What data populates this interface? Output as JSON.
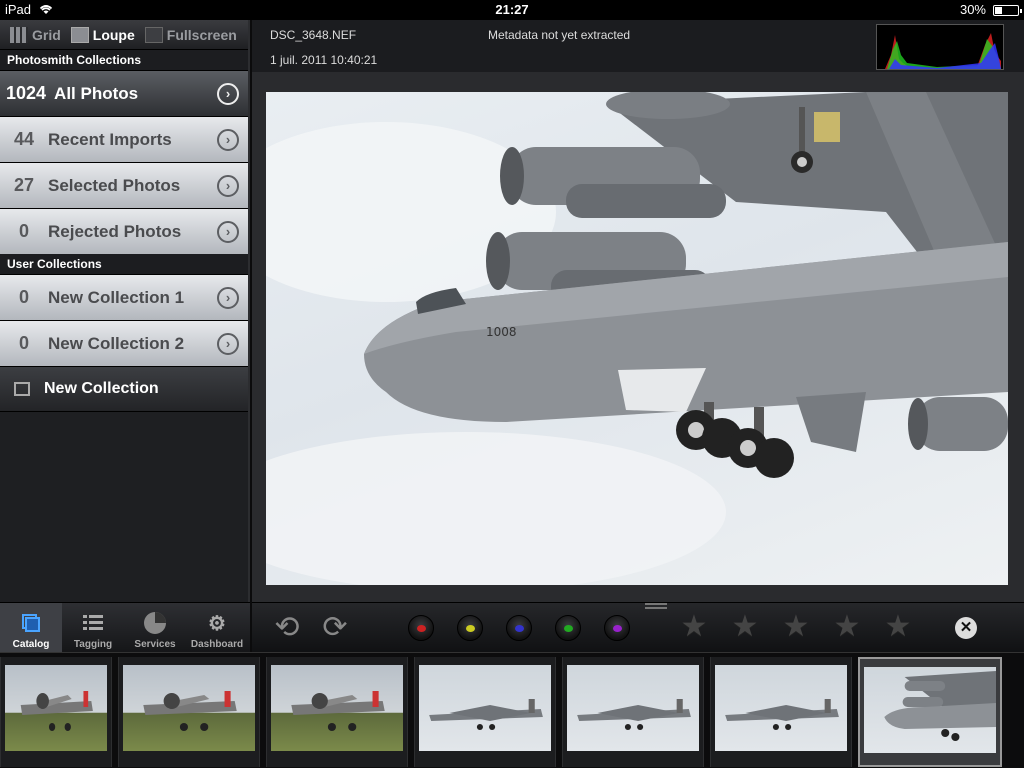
{
  "status": {
    "device": "iPad",
    "time": "21:27",
    "battery": "30%",
    "battery_level": 0.3
  },
  "viewmodes": [
    {
      "label": "Grid",
      "active": false
    },
    {
      "label": "Loupe",
      "active": true
    },
    {
      "label": "Fullscreen",
      "active": false
    }
  ],
  "sections": {
    "photosmith": "Photosmith Collections",
    "user": "User Collections"
  },
  "collections": [
    {
      "count": "1024",
      "label": "All Photos",
      "selected": true
    },
    {
      "count": "44",
      "label": "Recent Imports"
    },
    {
      "count": "27",
      "label": "Selected Photos"
    },
    {
      "count": "0",
      "label": "Rejected Photos"
    }
  ],
  "user_collections": [
    {
      "count": "0",
      "label": "New Collection 1"
    },
    {
      "count": "0",
      "label": "New Collection 2"
    }
  ],
  "new_collection": "New Collection",
  "tabs": [
    {
      "label": "Catalog",
      "icon": "catalog-icon",
      "active": true
    },
    {
      "label": "Tagging",
      "icon": "list-icon"
    },
    {
      "label": "Services",
      "icon": "pie-icon"
    },
    {
      "label": "Dashboard",
      "icon": "gear-icon"
    }
  ],
  "photo": {
    "filename": "DSC_3648.NEF",
    "datetime": "1 juil. 2011 10:40:21",
    "metadata_status": "Metadata not yet extracted"
  },
  "toolbar": {
    "color_labels": [
      "#c22",
      "#cc2",
      "#33c",
      "#2a2",
      "#92c"
    ],
    "star_count": 5
  },
  "filmstrip": [
    {
      "kind": "prop-plane",
      "bg": "field"
    },
    {
      "kind": "prop-plane",
      "bg": "field"
    },
    {
      "kind": "prop-plane-close",
      "bg": "field"
    },
    {
      "kind": "b52",
      "bg": "sky"
    },
    {
      "kind": "b52",
      "bg": "sky"
    },
    {
      "kind": "b52",
      "bg": "sky"
    },
    {
      "kind": "b52-close",
      "bg": "sky",
      "selected": true
    }
  ]
}
